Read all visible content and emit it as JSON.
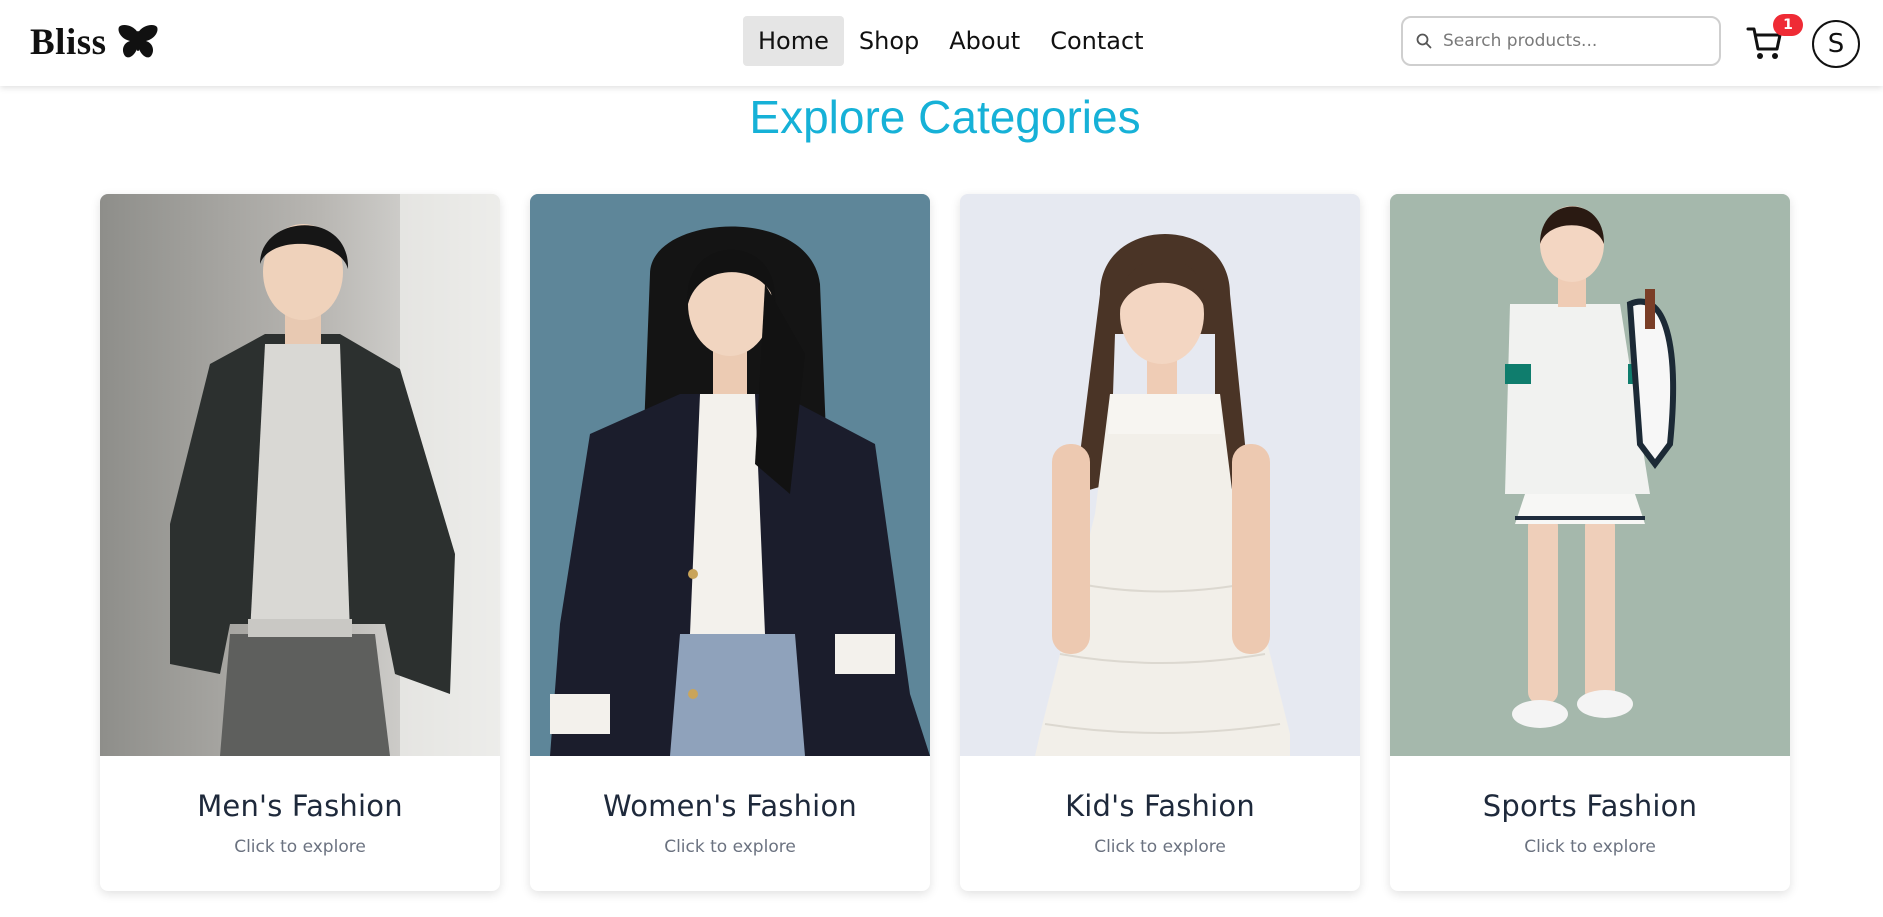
{
  "brand": {
    "name": "Bliss",
    "logo_icon": "butterfly-icon"
  },
  "nav": {
    "links": [
      {
        "label": "Home",
        "active": true
      },
      {
        "label": "Shop",
        "active": false
      },
      {
        "label": "About",
        "active": false
      },
      {
        "label": "Contact",
        "active": false
      }
    ]
  },
  "search": {
    "placeholder": "Search products...",
    "value": "",
    "icon": "search-icon"
  },
  "cart": {
    "icon": "cart-icon",
    "count": "1"
  },
  "user": {
    "initial": "S"
  },
  "main": {
    "title": "Explore Categories",
    "categories": [
      {
        "title": "Men's Fashion",
        "subtitle": "Click to explore",
        "image": "men-fashion-photo"
      },
      {
        "title": "Women's Fashion",
        "subtitle": "Click to explore",
        "image": "women-fashion-photo"
      },
      {
        "title": "Kid's Fashion",
        "subtitle": "Click to explore",
        "image": "kids-fashion-photo"
      },
      {
        "title": "Sports Fashion",
        "subtitle": "Click to explore",
        "image": "sports-fashion-photo"
      }
    ]
  },
  "colors": {
    "accent": "#16b1d7",
    "badge": "#ef2b35",
    "nav_active_bg": "#e5e5e5"
  }
}
